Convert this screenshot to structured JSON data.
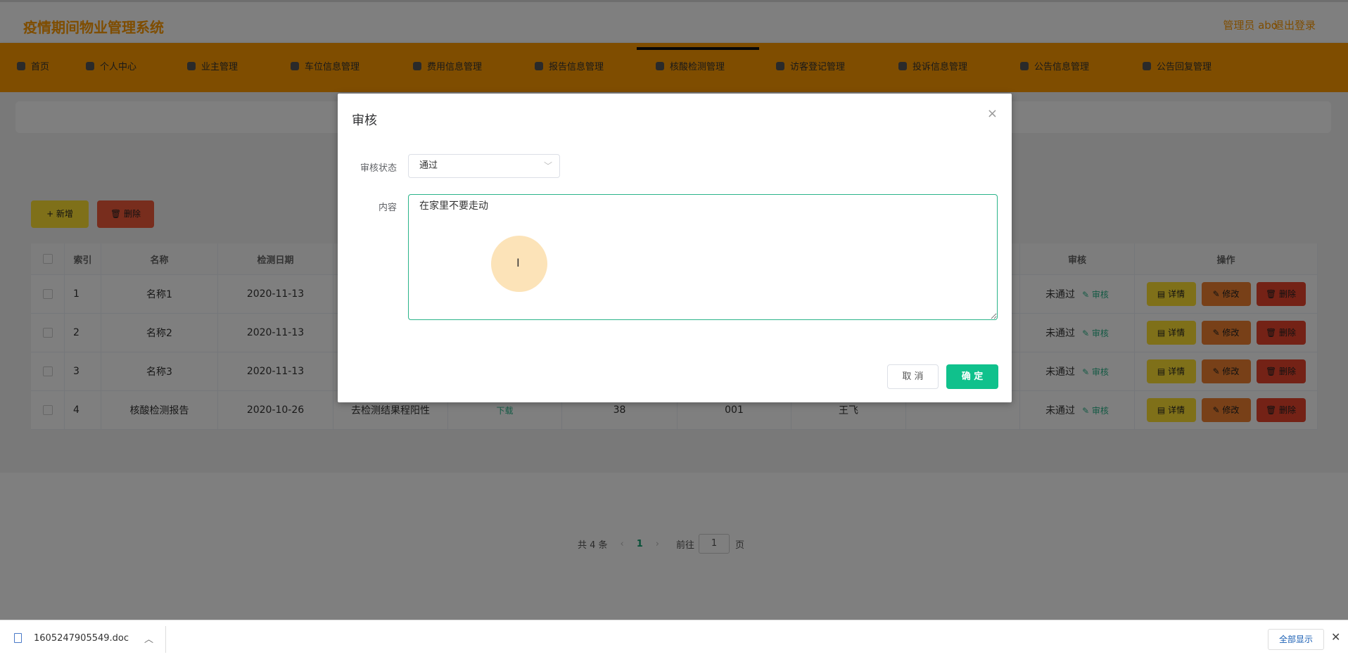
{
  "header": {
    "title": "疫情期间物业管理系统",
    "user": "管理员 abo",
    "logout": "退出登录"
  },
  "nav": [
    {
      "label": "首页"
    },
    {
      "label": "个人中心"
    },
    {
      "label": "业主管理"
    },
    {
      "label": "车位信息管理"
    },
    {
      "label": "费用信息管理"
    },
    {
      "label": "报告信息管理"
    },
    {
      "label": "核酸检测管理",
      "active": true
    },
    {
      "label": "访客登记管理"
    },
    {
      "label": "投诉信息管理"
    },
    {
      "label": "公告信息管理"
    },
    {
      "label": "公告回复管理"
    }
  ],
  "toolbar": {
    "add": "+ 新增",
    "delete": "🗑 删除"
  },
  "table": {
    "headers": [
      "索引",
      "名称",
      "检测日期",
      "",
      "",
      "",
      "",
      "",
      "",
      "审核",
      "操作"
    ],
    "rows": [
      {
        "index": "1",
        "name": "名称1",
        "date": "2020-11-13",
        "c5": "",
        "c6": "",
        "c7": "",
        "c8": "",
        "c9": "",
        "c10": "",
        "status": "未通过"
      },
      {
        "index": "2",
        "name": "名称2",
        "date": "2020-11-13",
        "c5": "",
        "c6": "",
        "c7": "",
        "c8": "",
        "c9": "",
        "c10": "",
        "status": "未通过"
      },
      {
        "index": "3",
        "name": "名称3",
        "date": "2020-11-13",
        "c5": "",
        "c6": "",
        "c7": "",
        "c8": "",
        "c9": "",
        "c10": "",
        "status": "未通过"
      },
      {
        "index": "4",
        "name": "核酸检测报告",
        "date": "2020-10-26",
        "c5": "去检测结果程阳性",
        "c6": "下载",
        "c7": "38",
        "c8": "001",
        "c9": "王飞",
        "c10": "",
        "status": "未通过"
      }
    ],
    "audit_link": "✎ 审核",
    "detail": "▤ 详情",
    "edit": "✎ 修改",
    "remove": "🗑 删除"
  },
  "pager": {
    "total": "共 4 条",
    "prev": "‹",
    "page": "1",
    "next": "›",
    "goto": "前往",
    "input": "1",
    "suffix": "页"
  },
  "modal": {
    "title": "审核",
    "close": "×",
    "status_label": "审核状态",
    "status_value": "通过",
    "content_label": "内容",
    "content_value": "在家里不要走动",
    "cancel": "取 消",
    "confirm": "确 定"
  },
  "download": {
    "file": "1605247905549.doc",
    "show_all": "全部显示",
    "close": "✕"
  },
  "colors": {
    "accent": "#ff9a00",
    "primary": "#10c18c"
  }
}
